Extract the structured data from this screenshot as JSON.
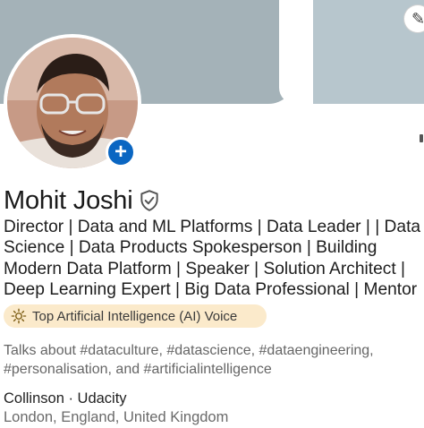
{
  "profile": {
    "name": "Mohit Joshi",
    "verified_icon": "verified-shield-icon",
    "headline_lines": [
      "Director | Data and ML Platforms | Data Leader | | Data",
      "Science | Data Products Spokesperson | Building",
      "Modern Data Platform | Speaker | Solution Architect |",
      "Deep Learning Expert | Big Data Professional | Mentor"
    ],
    "badge": {
      "icon": "lightbulb-icon",
      "label": "Top Artificial Intelligence (AI) Voice"
    },
    "talks_about_lines": [
      "Talks about #dataculture, #datascience, #dataengineering,",
      "#personalisation, and #artificialintelligence"
    ],
    "companies": "Collinson · Udacity",
    "location": "London, England, United Kingdom"
  },
  "avatar": {
    "add_button_symbol": "+",
    "add_button_icon": "plus-icon"
  },
  "colors": {
    "accent": "#0a66c2",
    "banner_left": "#a4b2b8",
    "banner_right": "#b7c6cd",
    "badge_bg": "#fbeacb",
    "muted_text": "#666666"
  }
}
